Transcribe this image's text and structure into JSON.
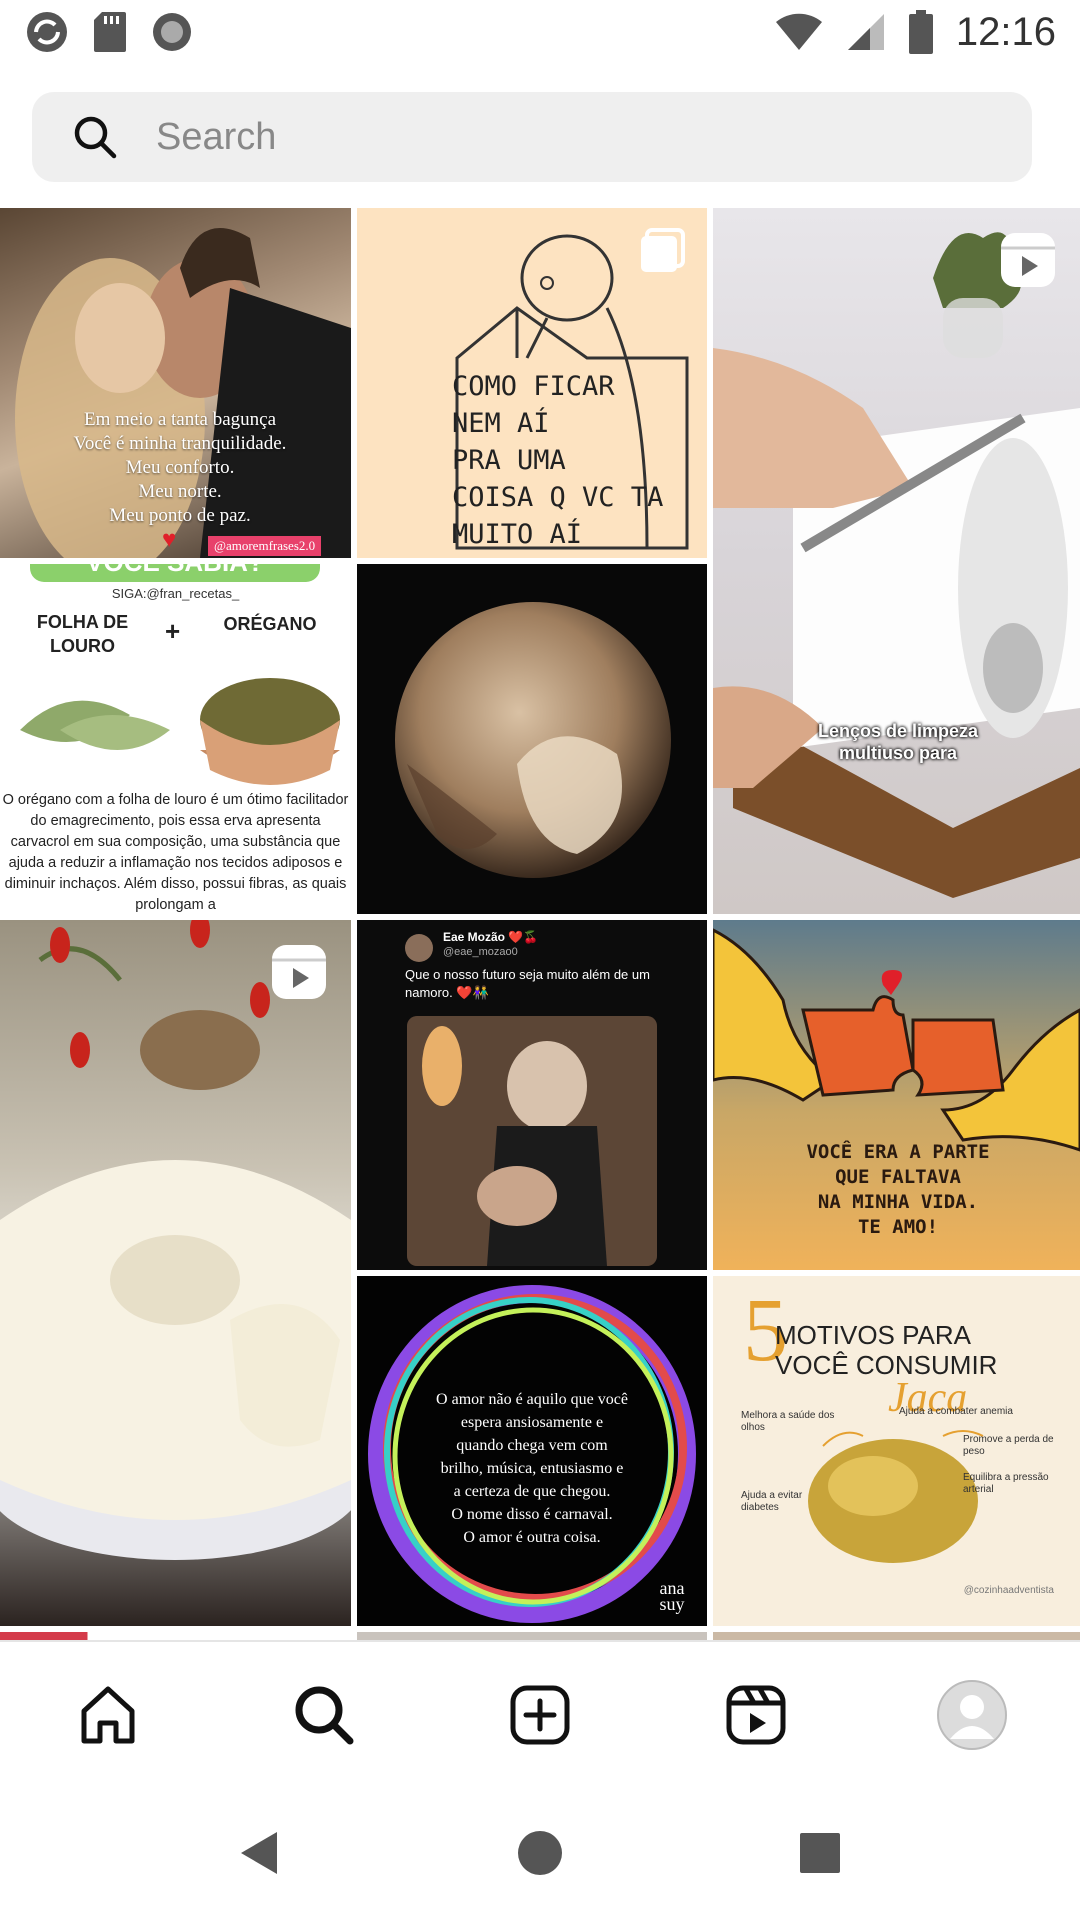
{
  "status_bar": {
    "time": "12:16",
    "icons_left": [
      "sync-icon",
      "sd-card-icon",
      "record-icon"
    ],
    "icons_right": [
      "wifi-icon",
      "signal-icon",
      "battery-icon"
    ]
  },
  "search": {
    "placeholder": "Search"
  },
  "tiles": {
    "t1": {
      "caption": "Em meio a tanta bagunça\nVocê é minha tranquilidade.\nMeu conforto.\nMeu norte.\nMeu ponto de paz.",
      "handle": "@amoremfrases2.0"
    },
    "t2": {
      "caption": "COMO FICAR\nNEM AÍ\nPRA UMA\nCOISA Q VC TA\nMUITO AÍ"
    },
    "t3": {
      "caption": "Lenços de limpeza\nmultiuso para"
    },
    "t4": {
      "banner": "VOCÊ SABIA?",
      "handle": "SIGA:@fran_recetas_",
      "left_label": "FOLHA DE\nLOURO",
      "plus": "+",
      "right_label": "ORÉGANO",
      "body": "O orégano com a folha de louro  é um ótimo facilitador do emagrecimento, pois essa erva apresenta carvacrol em sua composição, uma substância que ajuda a reduzir a inflamação nos tecidos adiposos e diminuir inchaços. Além disso, possui fibras, as quais prolongam a"
    },
    "t7": {
      "name": "Eae Mozão ❤️🍒",
      "user": "@eae_mozao0",
      "text": "Que o nosso futuro seja muito além de um namoro. ❤️👫"
    },
    "t8": {
      "caption": "VOCÊ ERA A PARTE\nQUE FALTAVA\nNA MINHA VIDA.\nTE AMO!"
    },
    "t9": {
      "caption": "O amor não é aquilo que você\nespera ansiosamente e\nquando chega vem com\nbrilho, música, entusiasmo e\na certeza de que chegou.\nO nome disso é carnaval.\nO amor é outra coisa.",
      "signature": "ana suy"
    },
    "t10": {
      "num": "5",
      "title": "MOTIVOS PARA\nVOCÊ CONSUMIR",
      "word": "Jaca",
      "points": [
        "Melhora a saúde dos olhos",
        "Ajuda a combater anemia",
        "Promove a perda de peso",
        "Equilibra a pressão arterial",
        "Ajuda a evitar diabetes"
      ],
      "handle": "@cozinhaadventista"
    }
  },
  "colors": {
    "search_bg": "#efefef",
    "nav_icon": "#111111"
  },
  "bottom_nav": [
    "home-icon",
    "search-icon",
    "create-icon",
    "reels-icon",
    "profile-icon"
  ],
  "system_nav": [
    "back-icon",
    "home-circle-icon",
    "recents-icon"
  ]
}
